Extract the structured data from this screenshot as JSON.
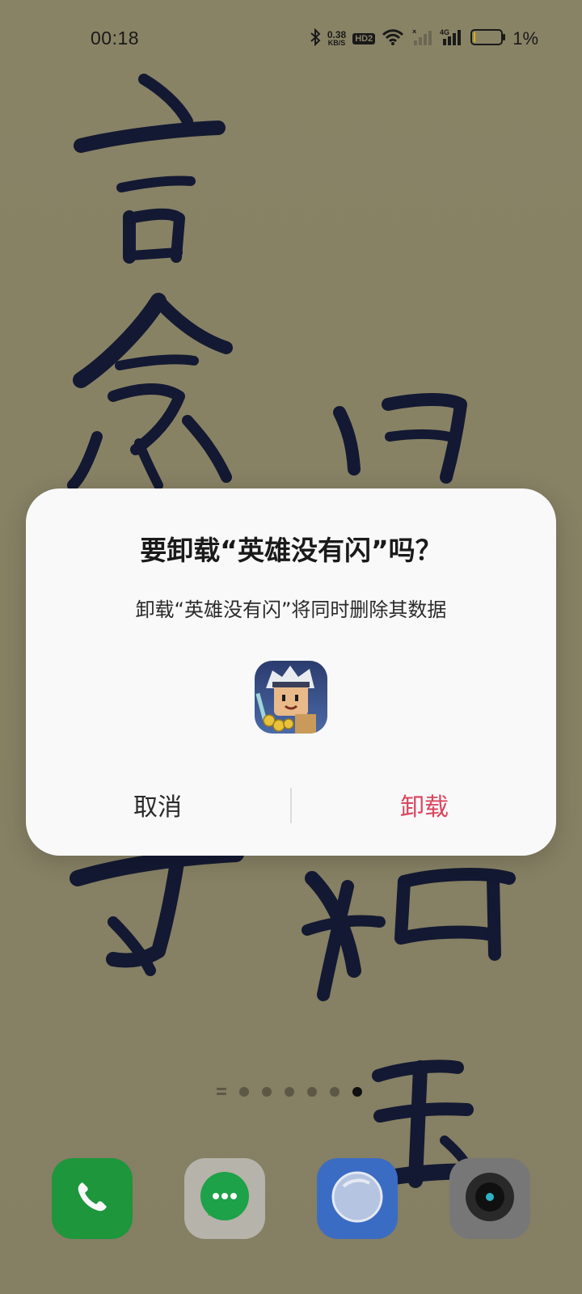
{
  "status_bar": {
    "time": "00:18",
    "net_speed_value": "0.38",
    "net_speed_unit": "KB/S",
    "hd_badge": "HD2",
    "network_type": "4G",
    "battery_percent": "1%",
    "icons": [
      "bluetooth-icon",
      "hd-voice-icon",
      "wifi-icon",
      "no-sim-signal-icon",
      "cellular-4g-icon",
      "battery-icon"
    ]
  },
  "dialog": {
    "title": "要卸载“英雄没有闪”吗？",
    "message": "卸载“英雄没有闪”将同时删除其数据",
    "app_icon": "hero-game-app-icon",
    "cancel_label": "取消",
    "uninstall_label": "卸载",
    "uninstall_color": "#d9465f"
  },
  "page_indicator": {
    "pages": 6,
    "active_index": 5
  },
  "dock": {
    "apps": [
      {
        "name": "phone",
        "icon": "phone-icon",
        "color": "#1f9a3e"
      },
      {
        "name": "messages",
        "icon": "message-bubble-icon",
        "color": "#1ea54b"
      },
      {
        "name": "browser",
        "icon": "browser-icon",
        "color": "#3d6fc7"
      },
      {
        "name": "camera",
        "icon": "camera-icon",
        "color": "#2a2a2a"
      }
    ]
  },
  "colors": {
    "wallpaper": "#8a8468",
    "ink": "#141a33",
    "dialog_bg": "#f9f9fa"
  }
}
